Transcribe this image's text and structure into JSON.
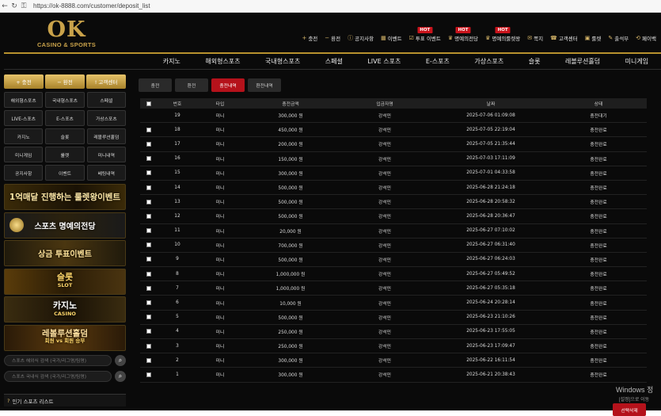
{
  "browser": {
    "url": "https://ok-8888.com/customer/deposit_list"
  },
  "logo": {
    "main": "OK",
    "sub": "CASINO & SPORTS"
  },
  "top_menu": [
    {
      "label": "충전",
      "icon": "plus-icon",
      "hot": ""
    },
    {
      "label": "환전",
      "icon": "minus-icon",
      "hot": ""
    },
    {
      "label": "공지사항",
      "icon": "info-icon",
      "hot": ""
    },
    {
      "label": "이벤트",
      "icon": "calendar-icon",
      "hot": ""
    },
    {
      "label": "투표 이벤트",
      "icon": "vote-icon",
      "hot": "HOT"
    },
    {
      "label": "명예의전당",
      "icon": "trophy-icon",
      "hot": "HOT"
    },
    {
      "label": "명예의룰렛왕",
      "icon": "trophy-icon",
      "hot": "HOT"
    },
    {
      "label": "쪽지",
      "icon": "message-icon",
      "hot": ""
    },
    {
      "label": "고객센터",
      "icon": "support-icon",
      "hot": ""
    },
    {
      "label": "룰렛",
      "icon": "gift-icon",
      "hot": ""
    },
    {
      "label": "출석부",
      "icon": "attendance-icon",
      "hot": ""
    },
    {
      "label": "페이백",
      "icon": "payback-icon",
      "hot": ""
    }
  ],
  "main_nav": [
    "카지노",
    "해외형스포츠",
    "국내형스포츠",
    "스페셜",
    "LIVE 스포츠",
    "E-스포츠",
    "가상스포츠",
    "슬롯",
    "레볼루션홀덤",
    "미니게임"
  ],
  "sidebar": {
    "top_buttons": [
      "+ 충전",
      "− 환전",
      "! 고객센터"
    ],
    "grid": [
      "해외형스포츠",
      "국내형스포츠",
      "스페셜",
      "LIVE-스포츠",
      "E-스포츠",
      "가상스포츠",
      "카지노",
      "슬롯",
      "레볼루션홀덤",
      "미니게임",
      "룰렛",
      "미니내역",
      "공지사항",
      "이벤트",
      "베팅내역"
    ],
    "banners": [
      {
        "line1": "1억매달 진행하는 룰렛왕이벤트",
        "line2": ""
      },
      {
        "line1": "스포츠 명예의전당",
        "line2": ""
      },
      {
        "line1": "상금 투표이벤트",
        "line2": ""
      },
      {
        "line1": "슬롯",
        "line2": "SLOT"
      },
      {
        "line1": "카지노",
        "line2": "CASINO"
      },
      {
        "line1": "레볼루션홀덤",
        "line2": "회원 vs 회원 승부"
      }
    ],
    "search1_placeholder": "스포츠 해외식 검색 (국가/리그명/팀명)",
    "search2_placeholder": "스포츠 국내식 검색 (국가/리그명/팀명)",
    "popular": "인기 스포츠 리스트"
  },
  "tabs": [
    {
      "label": "충전",
      "active": false
    },
    {
      "label": "환전",
      "active": false
    },
    {
      "label": "충전내역",
      "active": true
    },
    {
      "label": "환전내역",
      "active": false
    }
  ],
  "table": {
    "headers": [
      "번호",
      "타입",
      "충전금액",
      "입금자명",
      "날짜",
      "상태"
    ],
    "rows": [
      [
        "19",
        "미니",
        "300,000 원",
        "강석민",
        "2025-07-06 01:09:08",
        "충전대기"
      ],
      [
        "18",
        "미니",
        "450,000 원",
        "강석민",
        "2025-07-05 22:19:04",
        "충전완료"
      ],
      [
        "17",
        "미니",
        "200,000 원",
        "강석민",
        "2025-07-05 21:35:44",
        "충전완료"
      ],
      [
        "16",
        "미니",
        "150,000 원",
        "강석민",
        "2025-07-03 17:11:09",
        "충전완료"
      ],
      [
        "15",
        "미니",
        "300,000 원",
        "강석민",
        "2025-07-01 04:33:58",
        "충전완료"
      ],
      [
        "14",
        "미니",
        "500,000 원",
        "강석민",
        "2025-06-28 21:24:18",
        "충전완료"
      ],
      [
        "13",
        "미니",
        "500,000 원",
        "강석민",
        "2025-06-28 20:58:32",
        "충전완료"
      ],
      [
        "12",
        "미니",
        "500,000 원",
        "강석민",
        "2025-06-28 20:36:47",
        "충전완료"
      ],
      [
        "11",
        "미니",
        "20,000 원",
        "강석민",
        "2025-06-27 07:10:02",
        "충전완료"
      ],
      [
        "10",
        "미니",
        "700,000 원",
        "강석민",
        "2025-06-27 06:31:40",
        "충전완료"
      ],
      [
        "9",
        "미니",
        "500,000 원",
        "강석민",
        "2025-06-27 06:24:03",
        "충전완료"
      ],
      [
        "8",
        "미니",
        "1,000,000 원",
        "강석민",
        "2025-06-27 05:49:52",
        "충전완료"
      ],
      [
        "7",
        "미니",
        "1,000,000 원",
        "강석민",
        "2025-06-27 05:35:18",
        "충전완료"
      ],
      [
        "6",
        "미니",
        "10,000 원",
        "강석민",
        "2025-06-24 20:28:14",
        "충전완료"
      ],
      [
        "5",
        "미니",
        "500,000 원",
        "강석민",
        "2025-06-23 21:10:26",
        "충전완료"
      ],
      [
        "4",
        "미니",
        "250,000 원",
        "강석민",
        "2025-06-23 17:55:05",
        "충전완료"
      ],
      [
        "3",
        "미니",
        "250,000 원",
        "강석민",
        "2025-06-23 17:09:47",
        "충전완료"
      ],
      [
        "2",
        "미니",
        "300,000 원",
        "강석민",
        "2025-06-22 16:11:54",
        "충전완료"
      ],
      [
        "1",
        "미니",
        "300,000 원",
        "강석민",
        "2025-06-21 20:38:43",
        "충전완료"
      ]
    ]
  },
  "delete_button": "선택삭제",
  "windows_watermark": {
    "line1": "Windows 정",
    "line2": "[설정]으로 이동"
  }
}
